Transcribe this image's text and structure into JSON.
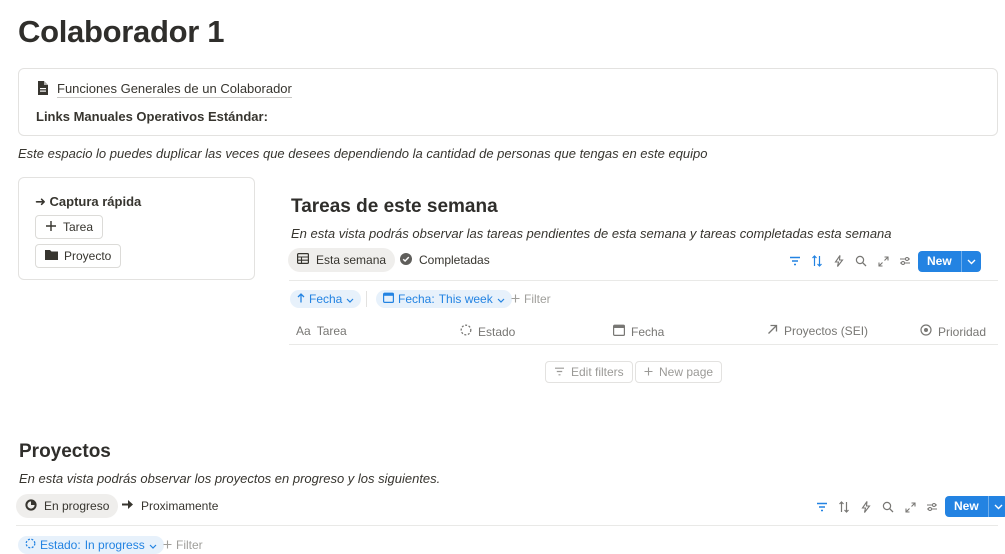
{
  "page": {
    "title": "Colaborador 1"
  },
  "callout": {
    "doc_link": "Funciones Generales de un Colaborador",
    "bold_text": "Links Manuales Operativos Estándar:"
  },
  "description": "Este espacio lo puedes duplicar las veces que desees dependiendo la cantidad de personas que tengas en este equipo",
  "quick_capture": {
    "title": "➜ Captura rápida",
    "buttons": [
      {
        "label": "Tarea",
        "icon": "plus-icon"
      },
      {
        "label": "Proyecto",
        "icon": "folder-icon"
      }
    ]
  },
  "tasks_view": {
    "title": "Tareas de este semana",
    "description": "En esta vista podrás observar las tareas pendientes de esta semana y tareas completadas esta semana",
    "tabs": [
      {
        "label": "Esta semana",
        "icon": "table-icon",
        "active": true
      },
      {
        "label": "Completadas",
        "icon": "check-circle-icon",
        "active": false
      }
    ],
    "new_label": "New",
    "sort_chip": "Fecha",
    "filter_chip_prefix": "Fecha:",
    "filter_chip_value": "This week",
    "add_filter": "Filter",
    "columns": [
      {
        "label": "Tarea",
        "icon": "text-aa-icon"
      },
      {
        "label": "Estado",
        "icon": "status-dashed-icon"
      },
      {
        "label": "Fecha",
        "icon": "calendar-icon"
      },
      {
        "label": "Proyectos (SEI)",
        "icon": "relation-arrow-icon"
      },
      {
        "label": "Prioridad",
        "icon": "select-circle-icon"
      }
    ],
    "edit_filters": "Edit filters",
    "new_page": "New page"
  },
  "projects_view": {
    "title": "Proyectos",
    "description": "En esta vista podrás observar los proyectos en progreso y los siguientes.",
    "tabs": [
      {
        "label": "En progreso",
        "icon": "progress-circle-icon",
        "active": true
      },
      {
        "label": "Proximamente",
        "icon": "arrow-right-icon",
        "active": false
      }
    ],
    "new_label": "New",
    "filter_chip_prefix": "Estado:",
    "filter_chip_value": "In progress",
    "add_filter": "Filter"
  },
  "colors": {
    "accent": "#2383e2",
    "text": "#37352f",
    "muted": "#787774",
    "border": "#e3e2e0"
  }
}
